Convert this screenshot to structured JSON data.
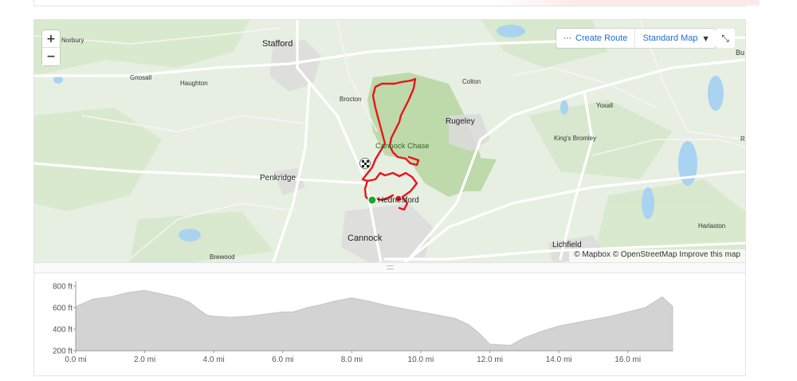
{
  "map": {
    "controls": {
      "zoom_in": "+",
      "zoom_out": "−",
      "create_route": "Create Route",
      "map_style": "Standard Map",
      "expand_icon": "expand-icon"
    },
    "attribution": {
      "mapbox": "© Mapbox",
      "osm": "© OpenStreetMap",
      "improve": "Improve this map"
    },
    "places": {
      "stafford": "Stafford",
      "norbury": "Norbury",
      "gnosall": "Gnosall",
      "haughton": "Haughton",
      "brocton": "Brocton",
      "colton": "Colton",
      "yoxall": "Yoxall",
      "rugeley": "Rugeley",
      "kings_bromley": "King's Bromley",
      "cannock_chase": "Cannock Chase",
      "penkridge": "Penkridge",
      "hednesford": "Hednesford",
      "cannock": "Cannock",
      "lichfield": "Lichfield",
      "harlaston": "Harlaston",
      "brewood": "Brewood",
      "bu": "Bu",
      "ri": "R"
    },
    "colors": {
      "route": "#e8161b",
      "start": "#1fa52a",
      "water": "#a9d3f0",
      "forest": "#c6dfb4"
    }
  },
  "elevation": {
    "chart_data": {
      "type": "area",
      "x_unit": "mi",
      "y_unit": "ft",
      "yticks": [
        "800 ft",
        "600 ft",
        "400 ft",
        "200 ft"
      ],
      "ytick_values": [
        800,
        600,
        400,
        200
      ],
      "xticks": [
        "0.0 mi",
        "2.0 mi",
        "4.0 mi",
        "6.0 mi",
        "8.0 mi",
        "10.0 mi",
        "12.0 mi",
        "14.0 mi",
        "16.0 mi"
      ],
      "xtick_values": [
        0,
        2,
        4,
        6,
        8,
        10,
        12,
        14,
        16
      ],
      "ylim": [
        200,
        800
      ],
      "xlim": [
        0,
        17.3
      ],
      "x": [
        0,
        0.5,
        1.0,
        1.5,
        2.0,
        2.3,
        2.6,
        3.0,
        3.3,
        3.5,
        3.8,
        4.0,
        4.5,
        5.0,
        5.5,
        6.0,
        6.3,
        6.7,
        7.0,
        7.5,
        8.0,
        8.5,
        9.0,
        9.5,
        10.0,
        10.5,
        11.0,
        11.4,
        11.7,
        12.0,
        12.3,
        12.6,
        13.0,
        13.5,
        14.0,
        14.5,
        15.0,
        15.5,
        16.0,
        16.5,
        17.0,
        17.3
      ],
      "y": [
        610,
        680,
        700,
        740,
        760,
        740,
        720,
        690,
        650,
        600,
        530,
        520,
        510,
        520,
        540,
        560,
        560,
        600,
        620,
        660,
        690,
        660,
        620,
        590,
        560,
        530,
        500,
        440,
        360,
        260,
        255,
        250,
        320,
        380,
        430,
        460,
        490,
        520,
        560,
        600,
        700,
        610
      ],
      "color": "#d3d3d3"
    }
  }
}
